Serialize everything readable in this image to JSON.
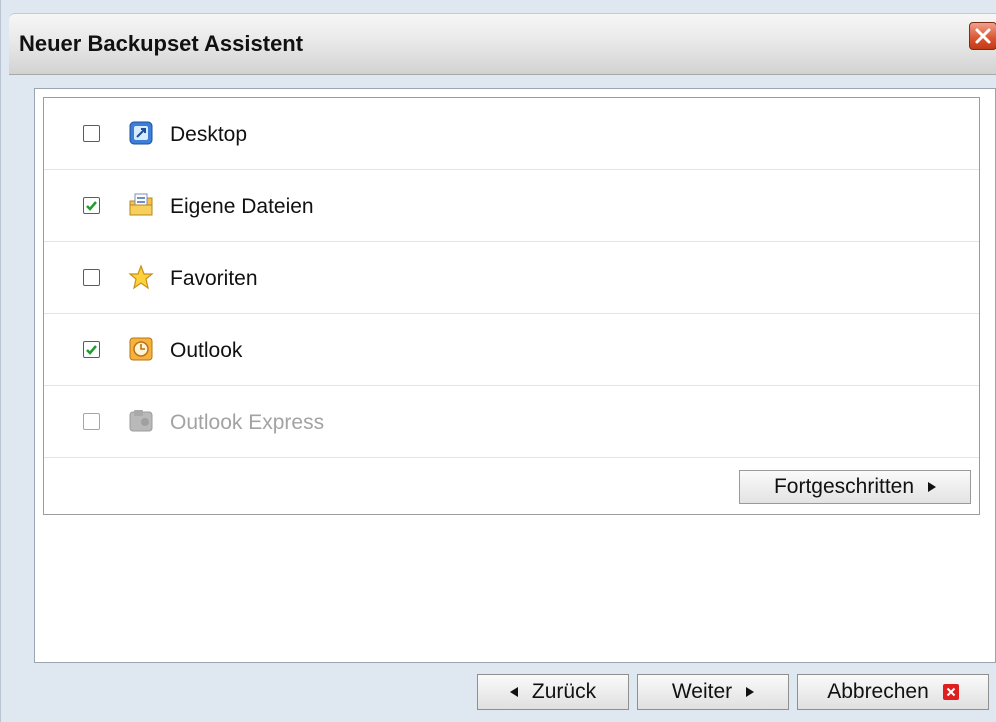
{
  "window": {
    "title": "Neuer Backupset Assistent",
    "close_icon": "close-icon"
  },
  "items": [
    {
      "label": "Desktop",
      "checked": false,
      "disabled": false,
      "icon": "desktop-icon"
    },
    {
      "label": "Eigene Dateien",
      "checked": true,
      "disabled": false,
      "icon": "documents-folder-icon"
    },
    {
      "label": "Favoriten",
      "checked": false,
      "disabled": false,
      "icon": "star-icon"
    },
    {
      "label": "Outlook",
      "checked": true,
      "disabled": false,
      "icon": "outlook-clock-icon"
    },
    {
      "label": "Outlook Express",
      "checked": false,
      "disabled": true,
      "icon": "outlook-express-icon"
    }
  ],
  "advanced_button": {
    "label": "Fortgeschritten",
    "icon": "arrow-right-icon"
  },
  "footer": {
    "back_label": "Zurück",
    "next_label": "Weiter",
    "cancel_label": "Abbrechen"
  },
  "colors": {
    "check_green": "#1f9e2f",
    "cancel_red": "#e01e1e",
    "disabled_text": "#a3a3a3"
  }
}
